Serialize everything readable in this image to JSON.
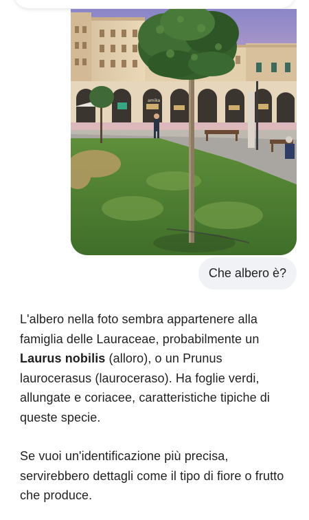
{
  "conversation": {
    "image": {
      "alt": "Foto di un albero in una piazza",
      "shop_sign": "amika"
    },
    "user_message": "Che albero è?",
    "assistant_reply": {
      "p1_intro": "L'albero nella foto sembra appartenere alla famiglia delle Lauraceae, probabilmente un ",
      "p1_bold": "Laurus nobilis",
      "p1_rest": " (alloro), o un Prunus laurocerasus (lauroceraso). Ha foglie verdi, allungate e coriacee, caratteristiche tipiche di queste specie.",
      "p2": "Se vuoi un'identificazione più precisa, servirebbero dettagli come il tipo di fiore o frutto che produce."
    }
  }
}
